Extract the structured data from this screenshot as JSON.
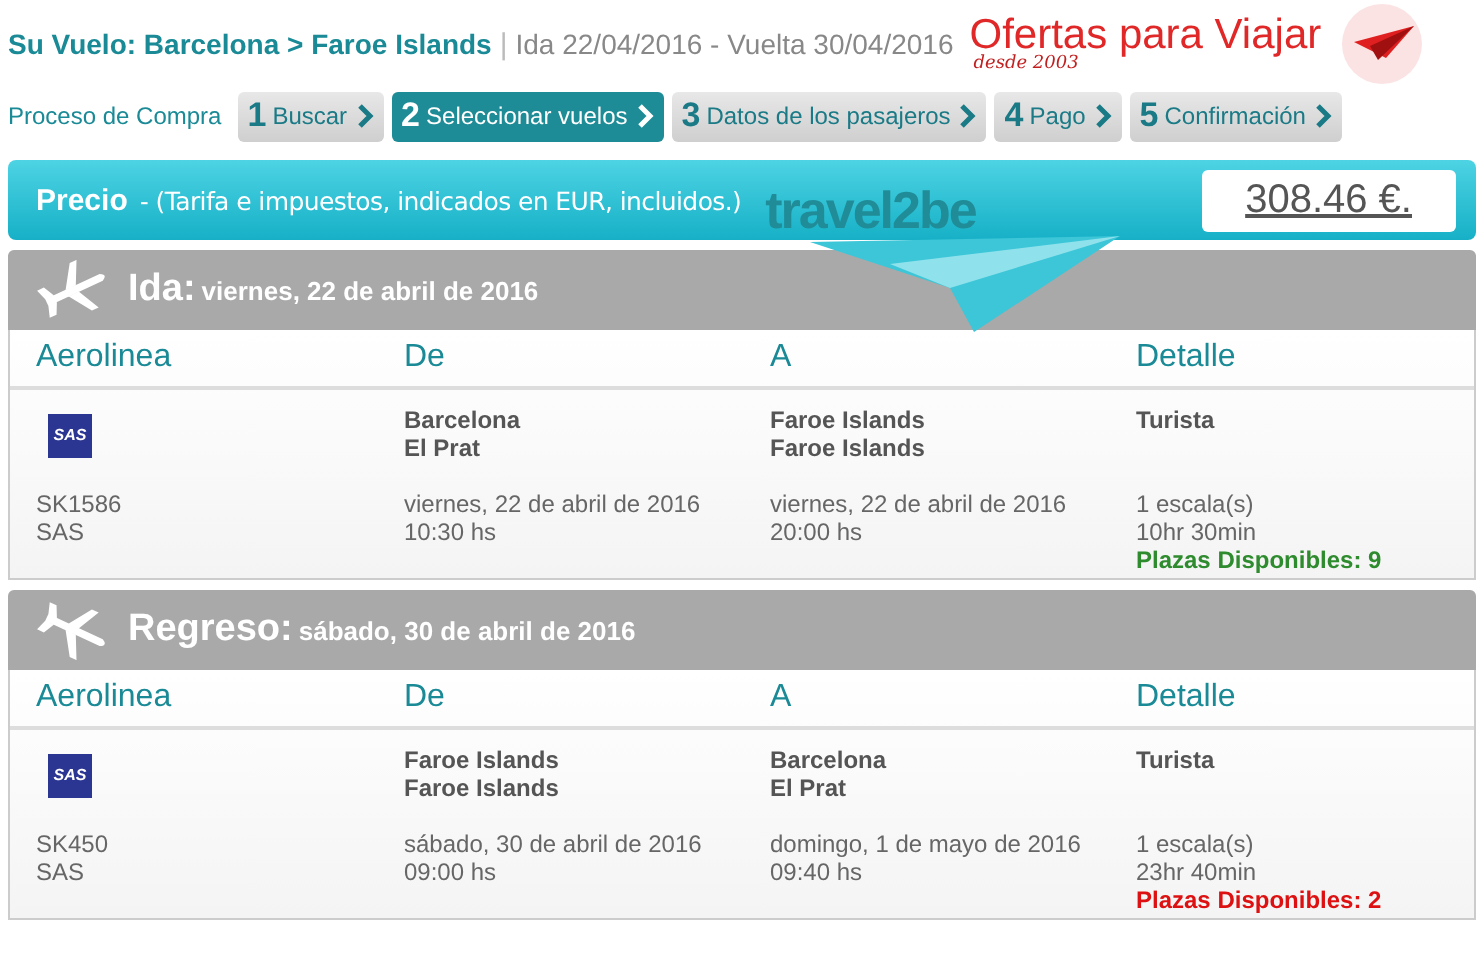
{
  "header": {
    "route_label": "Su Vuelo:",
    "origin": "Barcelona",
    "arrow": ">",
    "destination": "Faroe Islands",
    "separator": "|",
    "dates": "Ida 22/04/2016 - Vuelta 30/04/2016",
    "brand": "Ofertas para Viajar",
    "brand_tagline": "desde 2003"
  },
  "steps_label": "Proceso de Compra",
  "steps": [
    {
      "number": "1",
      "label": "Buscar",
      "selected": false
    },
    {
      "number": "2",
      "label": "Seleccionar vuelos",
      "selected": true
    },
    {
      "number": "3",
      "label": "Datos de los pasajeros",
      "selected": false
    },
    {
      "number": "4",
      "label": "Pago",
      "selected": false
    },
    {
      "number": "5",
      "label": "Confirmación",
      "selected": false
    }
  ],
  "price_bar": {
    "label": "Precio",
    "note": "- (Tarifa e impuestos, indicados en EUR, incluidos.)",
    "logo": "travel2be",
    "price": "308.46 €."
  },
  "legs": [
    {
      "kind": "departure",
      "columns": [
        "Aerolinea",
        "De",
        "A",
        "Detalle"
      ],
      "title": "Ida:",
      "date": "viernes, 22 de abril de 2016",
      "airline_logo": "SAS",
      "from_city": "Barcelona",
      "from_airport": "El Prat",
      "to_city": "Faroe Islands",
      "to_airport": "Faroe Islands",
      "class": "Turista",
      "flight": "SK1586",
      "airline": "SAS",
      "dep_date": "viernes, 22 de abril de 2016",
      "dep_time": "10:30 hs",
      "arr_date": "viernes, 22 de abril de 2016",
      "arr_time": "20:00 hs",
      "stops": "1 escala(s)",
      "duration": "10hr 30min",
      "seats": {
        "text": "Plazas Disponibles: 9",
        "color": "#2e8b2e"
      }
    },
    {
      "kind": "return",
      "columns": [
        "Aerolinea",
        "De",
        "A",
        "Detalle"
      ],
      "title": "Regreso:",
      "date": "sábado, 30 de abril de 2016",
      "airline_logo": "SAS",
      "from_city": "Faroe Islands",
      "from_airport": "Faroe Islands",
      "to_city": "Barcelona",
      "to_airport": "El Prat",
      "class": "Turista",
      "flight": "SK450",
      "airline": "SAS",
      "dep_date": "sábado, 30 de abril de 2016",
      "dep_time": "09:00 hs",
      "arr_date": "domingo, 1 de mayo de 2016",
      "arr_time": "09:40 hs",
      "stops": "1 escala(s)",
      "duration": "23hr 40min",
      "seats": {
        "text": "Plazas Disponibles: 2",
        "color": "#dd1111"
      }
    }
  ]
}
